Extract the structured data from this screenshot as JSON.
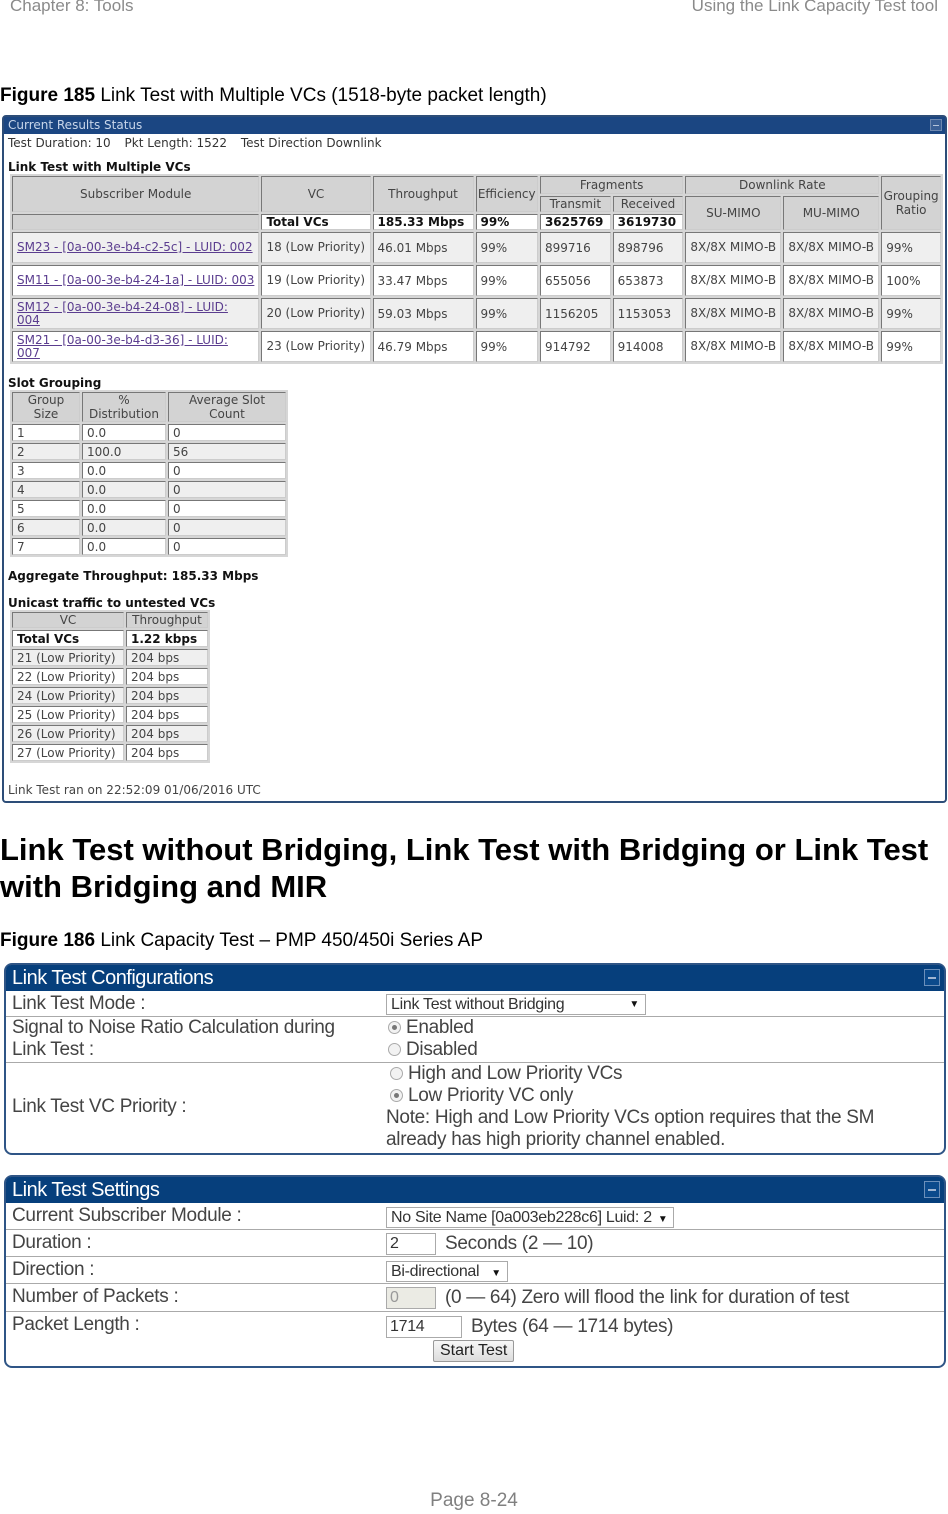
{
  "page": {
    "header_left": "Chapter 8:  Tools",
    "header_right": "Using the Link Capacity Test tool",
    "footer": "Page 8-24",
    "section_heading": "Link Test without Bridging, Link Test with Bridging or Link Test with Bridging and MIR"
  },
  "figure185": {
    "caption_num": "Figure 185",
    "caption_text": " Link Test with Multiple VCs (1518-byte packet length)",
    "panel_title": "Current Results Status",
    "info": {
      "duration": "Test Duration: 10",
      "pkt_length": "Pkt Length: 1522",
      "direction": "Test Direction Downlink"
    },
    "multi_vc": {
      "heading": "Link Test with Multiple VCs",
      "headers": {
        "subscriber_module": "Subscriber Module",
        "vc": "VC",
        "throughput": "Throughput",
        "efficiency": "Efficiency",
        "fragments": "Fragments",
        "transmit": "Transmit",
        "received": "Received",
        "downlink_rate": "Downlink Rate",
        "su_mimo": "SU-MIMO",
        "mu_mimo": "MU-MIMO",
        "grouping_ratio": "Grouping Ratio"
      },
      "totals": {
        "label": "Total VCs",
        "throughput": "185.33 Mbps",
        "efficiency": "99%",
        "transmit": "3625769",
        "received": "3619730"
      },
      "rows": [
        {
          "sm": "SM23 - [0a-00-3e-b4-c2-5c] - LUID: 002",
          "vc": "18 (Low Priority)",
          "throughput": "46.01 Mbps",
          "efficiency": "99%",
          "transmit": "899716",
          "received": "898796",
          "su_mimo": "8X/8X MIMO-B",
          "mu_mimo": "8X/8X MIMO-B",
          "grouping": "99%"
        },
        {
          "sm": "SM11 - [0a-00-3e-b4-24-1a] - LUID: 003",
          "vc": "19 (Low Priority)",
          "throughput": "33.47 Mbps",
          "efficiency": "99%",
          "transmit": "655056",
          "received": "653873",
          "su_mimo": "8X/8X MIMO-B",
          "mu_mimo": "8X/8X MIMO-B",
          "grouping": "100%"
        },
        {
          "sm": "SM12 - [0a-00-3e-b4-24-08] - LUID: 004",
          "vc": "20 (Low Priority)",
          "throughput": "59.03 Mbps",
          "efficiency": "99%",
          "transmit": "1156205",
          "received": "1153053",
          "su_mimo": "8X/8X MIMO-B",
          "mu_mimo": "8X/8X MIMO-B",
          "grouping": "99%"
        },
        {
          "sm": "SM21 - [0a-00-3e-b4-d3-36] - LUID: 007",
          "vc": "23 (Low Priority)",
          "throughput": "46.79 Mbps",
          "efficiency": "99%",
          "transmit": "914792",
          "received": "914008",
          "su_mimo": "8X/8X MIMO-B",
          "mu_mimo": "8X/8X MIMO-B",
          "grouping": "99%"
        }
      ]
    },
    "slot_grouping": {
      "heading": "Slot Grouping",
      "headers": [
        "Group Size",
        "% Distribution",
        "Average Slot Count"
      ],
      "rows": [
        [
          "1",
          "0.0",
          "0"
        ],
        [
          "2",
          "100.0",
          "56"
        ],
        [
          "3",
          "0.0",
          "0"
        ],
        [
          "4",
          "0.0",
          "0"
        ],
        [
          "5",
          "0.0",
          "0"
        ],
        [
          "6",
          "0.0",
          "0"
        ],
        [
          "7",
          "0.0",
          "0"
        ]
      ]
    },
    "aggregate": "Aggregate Throughput: 185.33 Mbps",
    "unicast": {
      "heading": "Unicast traffic to untested VCs",
      "headers": [
        "VC",
        "Throughput"
      ],
      "total": [
        "Total VCs",
        "1.22 kbps"
      ],
      "rows": [
        [
          "21 (Low Priority)",
          "204 bps"
        ],
        [
          "22 (Low Priority)",
          "204 bps"
        ],
        [
          "24 (Low Priority)",
          "204 bps"
        ],
        [
          "25 (Low Priority)",
          "204 bps"
        ],
        [
          "26 (Low Priority)",
          "204 bps"
        ],
        [
          "27 (Low Priority)",
          "204 bps"
        ]
      ]
    },
    "ran_on": "Link Test ran on 22:52:09 01/06/2016 UTC"
  },
  "figure186": {
    "caption_num": "Figure 186",
    "caption_text": " Link Capacity Test – PMP 450/450i Series AP",
    "config": {
      "title": "Link Test Configurations",
      "mode_label": "Link Test Mode :",
      "mode_value": "Link Test without Bridging",
      "snr_label_1": "Signal to Noise Ratio Calculation during",
      "snr_label_2": "Link Test :",
      "snr_options": [
        {
          "label": "Enabled",
          "selected": true
        },
        {
          "label": "Disabled",
          "selected": false
        }
      ],
      "priority_label": "Link Test VC Priority :",
      "priority_options": [
        {
          "label": "High and Low Priority VCs",
          "selected": false
        },
        {
          "label": "Low Priority VC only",
          "selected": true
        }
      ],
      "note_1": "Note: High and Low Priority VCs option requires that the SM",
      "note_2": "already has high priority channel enabled."
    },
    "settings": {
      "title": "Link Test Settings",
      "sm_label": "Current Subscriber Module :",
      "sm_value": "No Site Name [0a003eb228c6] Luid: 2",
      "duration_label": "Duration :",
      "duration_value": "2",
      "duration_hint": "Seconds (2 — 10)",
      "direction_label": "Direction :",
      "direction_value": "Bi-directional",
      "packets_label": "Number of Packets :",
      "packets_value": "0",
      "packets_hint": "(0 — 64) Zero will flood the link for duration of test",
      "length_label": "Packet Length :",
      "length_value": "1714",
      "length_hint": "Bytes (64 — 1714 bytes)",
      "start_button": "Start Test"
    }
  }
}
